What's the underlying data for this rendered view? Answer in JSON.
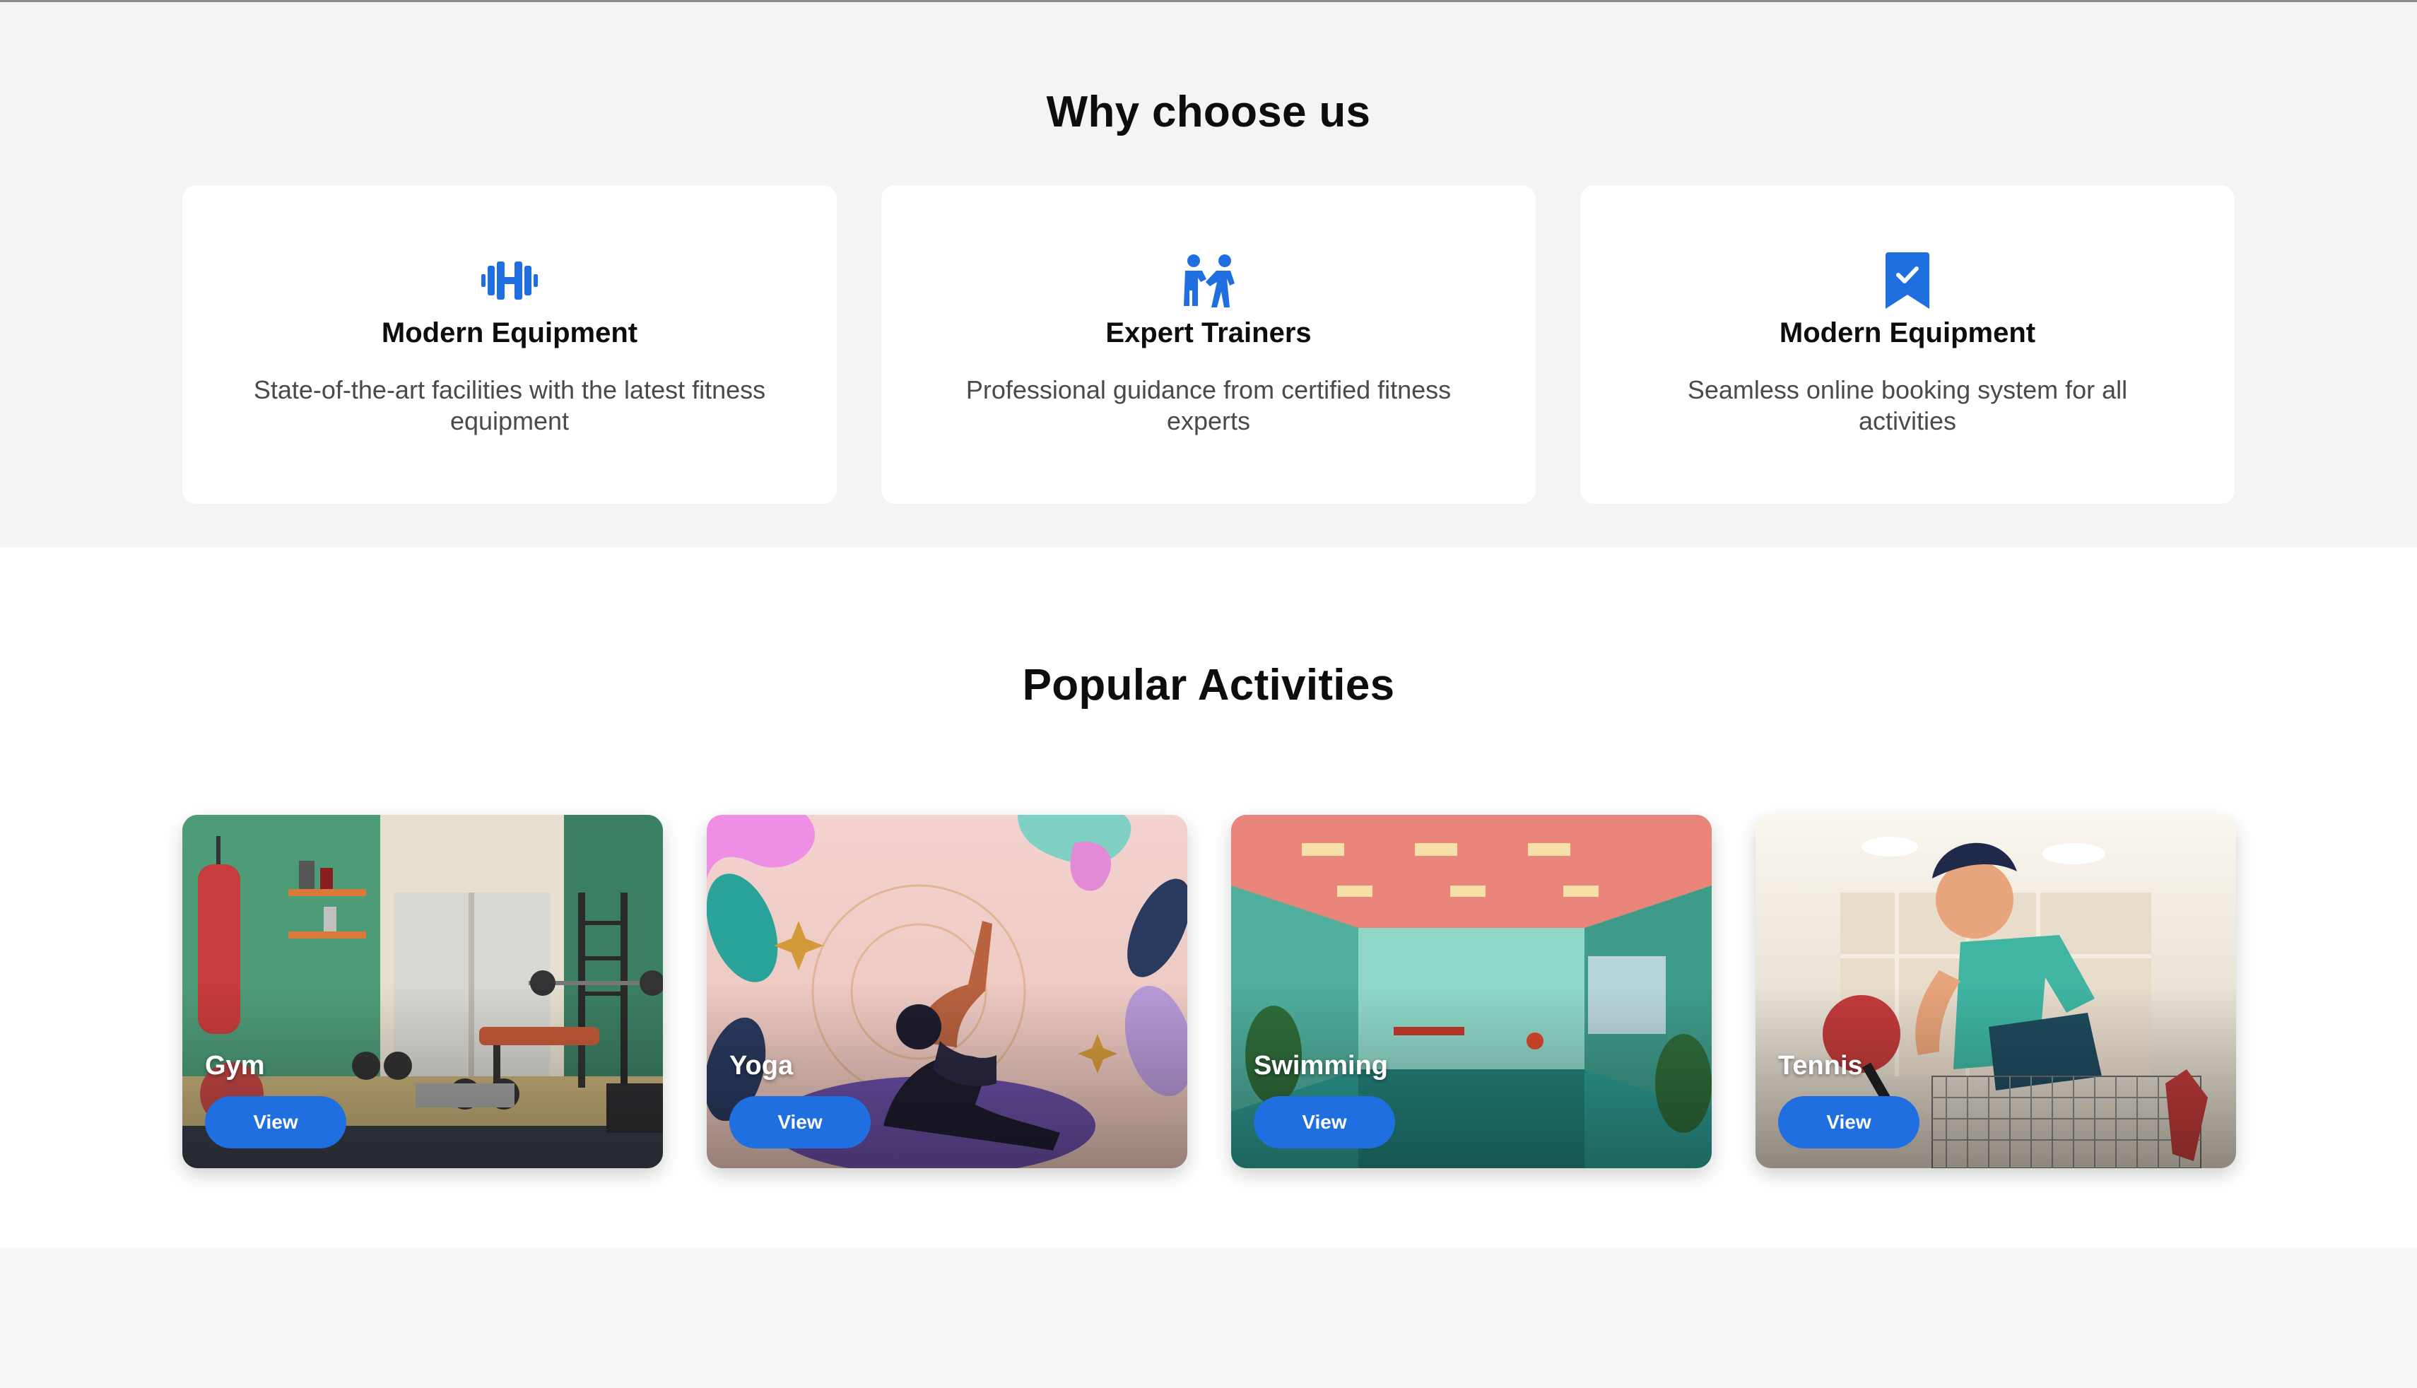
{
  "why": {
    "title": "Why choose us",
    "features": [
      {
        "icon": "dumbbell-icon",
        "title": "Modern Equipment",
        "desc": "State-of-the-art facilities with the latest fitness equipment"
      },
      {
        "icon": "trainers-icon",
        "title": "Expert Trainers",
        "desc": "Professional guidance from certified fitness experts"
      },
      {
        "icon": "bookmark-check-icon",
        "title": "Modern Equipment",
        "desc": "Seamless online booking system for all activities"
      }
    ]
  },
  "popular": {
    "title": "Popular Activities",
    "activities": [
      {
        "name": "Gym",
        "button": "View"
      },
      {
        "name": "Yoga",
        "button": "View"
      },
      {
        "name": "Swimming",
        "button": "View"
      },
      {
        "name": "Tennis",
        "button": "View"
      }
    ]
  },
  "colors": {
    "accent": "#1f6fe0",
    "section_bg": "#f4f4f4",
    "card_bg": "#ffffff"
  }
}
